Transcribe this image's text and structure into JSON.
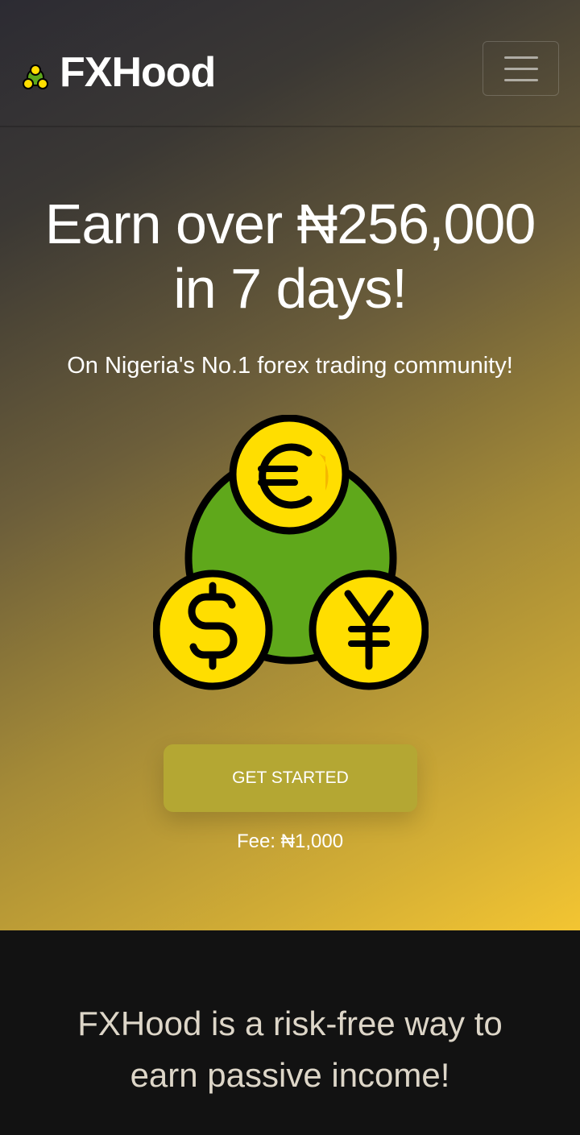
{
  "header": {
    "brand_name": "FXHood",
    "logo_icon": "coins-icon"
  },
  "hero": {
    "headline_line1": "Earn over ₦256,000",
    "headline_line2": "in 7 days!",
    "subheadline": "On Nigeria's No.1 forex trading community!",
    "illustration_icons": [
      "euro-coin-icon",
      "dollar-coin-icon",
      "yen-coin-icon"
    ],
    "cta_label": "GET STARTED",
    "fee_text": "Fee: ₦1,000"
  },
  "about": {
    "line1": "FXHood is a risk-free way to",
    "line2": "earn passive income!"
  },
  "colors": {
    "gradient_start": "#2c2b33",
    "gradient_end": "#f3c532",
    "cta_background": "#b4a733",
    "coin_yellow": "#ffde00",
    "globe_green": "#5fa81b",
    "about_background": "#121212"
  }
}
